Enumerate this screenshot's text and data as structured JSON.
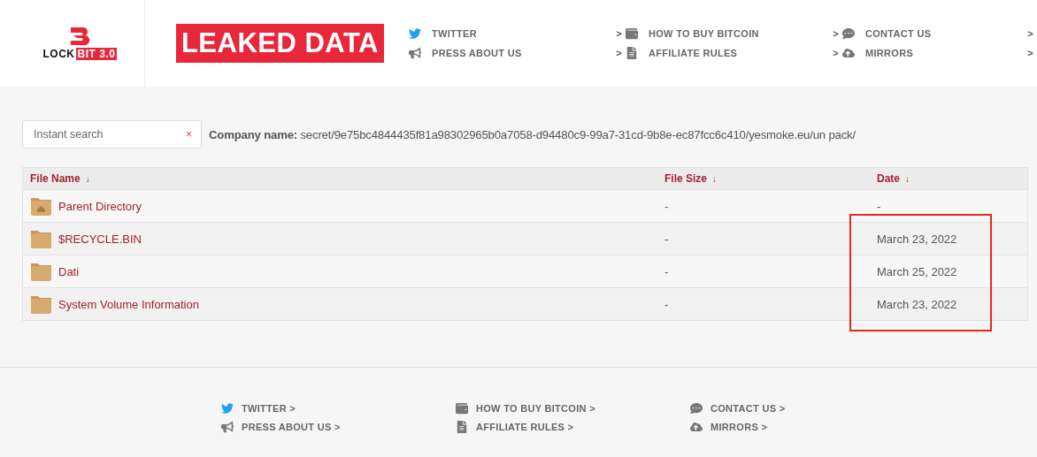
{
  "logo": {
    "text": "LOCK",
    "badge": "BIT 3.0"
  },
  "title": "LEAKED DATA",
  "nav": [
    {
      "label": "TWITTER",
      "arrow": ">"
    },
    {
      "label": "PRESS ABOUT US",
      "arrow": ">"
    },
    {
      "label": "HOW TO BUY BITCOIN",
      "arrow": ">"
    },
    {
      "label": "AFFILIATE RULES",
      "arrow": ">"
    },
    {
      "label": "CONTACT US",
      "arrow": ">"
    },
    {
      "label": "MIRRORS",
      "arrow": ">"
    }
  ],
  "search": {
    "placeholder": "Instant search",
    "clear": "×"
  },
  "company": {
    "label": "Company name:",
    "value": "secret/9e75bc4844435f81a98302965b0a7058-d94480c9-99a7-31cd-9b8e-ec87fcc6c410/yesmoke.eu/un pack/"
  },
  "table": {
    "columns": [
      {
        "label": "File Name",
        "sort": "↓"
      },
      {
        "label": "File Size",
        "sort": "↓"
      },
      {
        "label": "Date",
        "sort": "↓"
      }
    ],
    "rows": [
      {
        "kind": "parent",
        "name": "Parent Directory",
        "size": "-",
        "date": "-"
      },
      {
        "kind": "folder",
        "name": "$RECYCLE.BIN",
        "size": "-",
        "date": "March 23, 2022"
      },
      {
        "kind": "folder",
        "name": "Dati",
        "size": "-",
        "date": "March 25, 2022"
      },
      {
        "kind": "folder",
        "name": "System Volume Information",
        "size": "-",
        "date": "March 23, 2022"
      }
    ]
  },
  "footer_nav": [
    {
      "label": "TWITTER",
      "arrow": ">"
    },
    {
      "label": "PRESS ABOUT US",
      "arrow": ">"
    },
    {
      "label": "HOW TO BUY BITCOIN",
      "arrow": ">"
    },
    {
      "label": "AFFILIATE RULES",
      "arrow": ">"
    },
    {
      "label": "CONTACT US",
      "arrow": ">"
    },
    {
      "label": "MIRRORS",
      "arrow": ">"
    }
  ]
}
